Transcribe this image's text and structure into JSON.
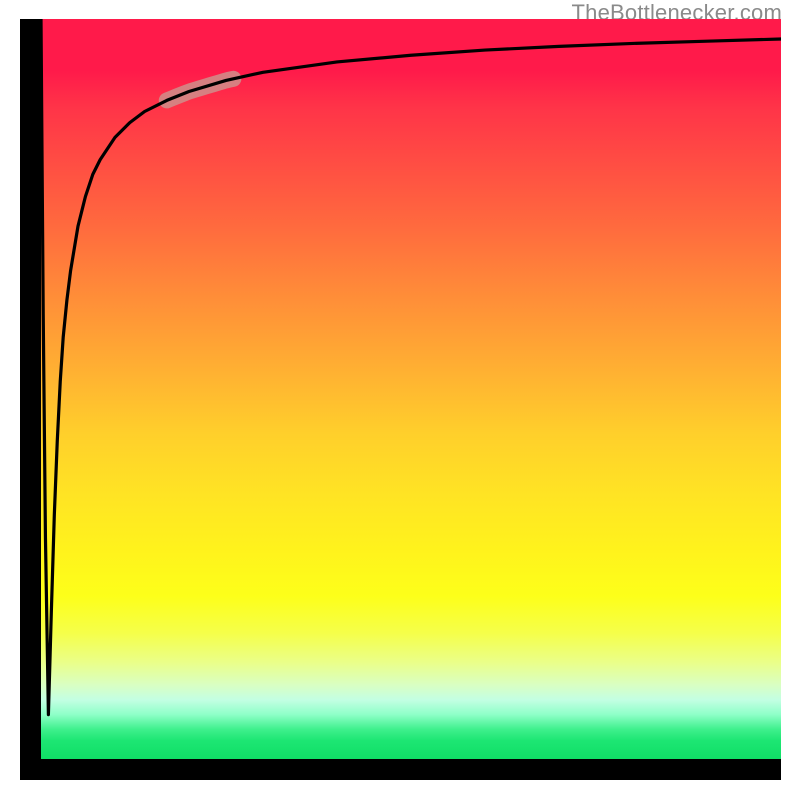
{
  "watermark": "TheBottlenecker.com",
  "colors": {
    "gradient_top": "#ff1a4a",
    "gradient_mid": "#ffd126",
    "gradient_bottom": "#10df66",
    "axis": "#000000",
    "curve": "#000000",
    "highlight_segment": "#cf8f8b"
  },
  "chart_data": {
    "type": "line",
    "title": "",
    "xlabel": "",
    "ylabel": "",
    "xlim": [
      0,
      100
    ],
    "ylim": [
      0,
      100
    ],
    "x": [
      0,
      0.3,
      0.6,
      1,
      1.4,
      1.8,
      2.2,
      2.6,
      3,
      3.5,
      4,
      5,
      6,
      7,
      8,
      10,
      12,
      14,
      17,
      20,
      25,
      30,
      40,
      50,
      60,
      70,
      80,
      90,
      100
    ],
    "values": [
      100,
      60,
      30,
      6,
      20,
      33,
      43,
      51,
      57,
      62,
      66,
      72,
      76,
      79,
      81,
      84,
      86,
      87.5,
      89,
      90.2,
      91.7,
      92.8,
      94.2,
      95.1,
      95.8,
      96.3,
      96.7,
      97.0,
      97.3
    ],
    "highlight_x_range": [
      17,
      26
    ],
    "notes": "y is percentage height within plot; the sharp dip near x≈1 touches the bottom then the curve rises logarithmically toward ~97 at x=100. The highlight range marks the thicker pale segment on the rising curve."
  }
}
